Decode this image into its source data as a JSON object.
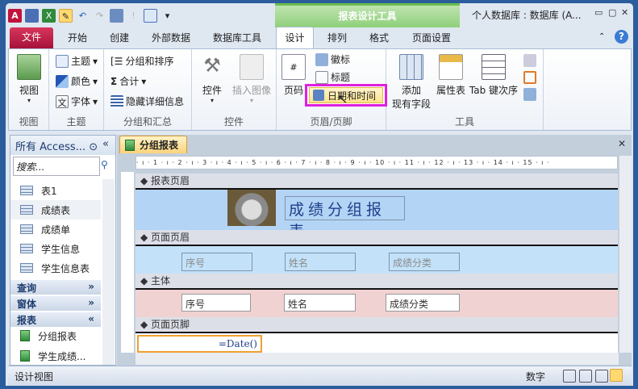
{
  "quick_access": {
    "icons": [
      "access-logo",
      "save-icon",
      "excel-export-icon",
      "design-view-icon",
      "undo-icon",
      "redo-icon",
      "form-view-icon",
      "help-icon",
      "datasheet-icon",
      "customize-icon"
    ]
  },
  "contextual_group": "报表设计工具",
  "window_title": "个人数据库 : 数据库 (A...",
  "tabs": [
    "文件",
    "开始",
    "创建",
    "外部数据",
    "数据库工具",
    "设计",
    "排列",
    "格式",
    "页面设置"
  ],
  "ribbon": {
    "view": {
      "label": "视图",
      "group": "视图"
    },
    "themes": {
      "items": [
        "主题",
        "颜色",
        "字体"
      ],
      "group": "主题"
    },
    "grouping": {
      "items": [
        "分组和排序",
        "合计",
        "隐藏详细信息"
      ],
      "group": "分组和汇总"
    },
    "controls": {
      "controls": "控件",
      "insert_image": "插入图像",
      "group": "控件"
    },
    "header_footer": {
      "page_number": "页码",
      "logo": "徽标",
      "title": "标题",
      "date_time": "日期和时间",
      "group": "页眉/页脚"
    },
    "tools": {
      "add_fields_1": "添加",
      "add_fields_2": "现有字段",
      "property_sheet": "属性表",
      "tab_order": "Tab 键次序",
      "group": "工具"
    }
  },
  "nav": {
    "header": "所有 Access...",
    "search_placeholder": "搜索...",
    "tables": [
      "表1",
      "成绩表",
      "成绩单",
      "学生信息",
      "学生信息表"
    ],
    "sections": [
      "查询",
      "窗体",
      "报表"
    ],
    "reports": [
      "分组报表",
      "学生成绩..."
    ]
  },
  "document": {
    "tab": "分组报表",
    "ruler": "· ı · 1 · ı · 2 · ı · 3 · ı · 4 · ı · 5 · ı · 6 · ı · 7 · ı · 8 · ı · 9 · ı · 10 · ı · 11 · ı · 12 · ı · 13 · ı · 14 · ı · 15 · ı ·",
    "sections": {
      "report_header": "报表页眉",
      "page_header": "页面页眉",
      "detail": "主体",
      "page_footer": "页面页脚"
    },
    "report_title": "成绩分组报表",
    "header_labels": [
      "序号",
      "姓名",
      "成绩分类"
    ],
    "detail_fields": [
      "序号",
      "姓名",
      "成绩分类"
    ],
    "footer_expr": "=Date()"
  },
  "status": {
    "left": "设计视图",
    "num": "数字"
  }
}
